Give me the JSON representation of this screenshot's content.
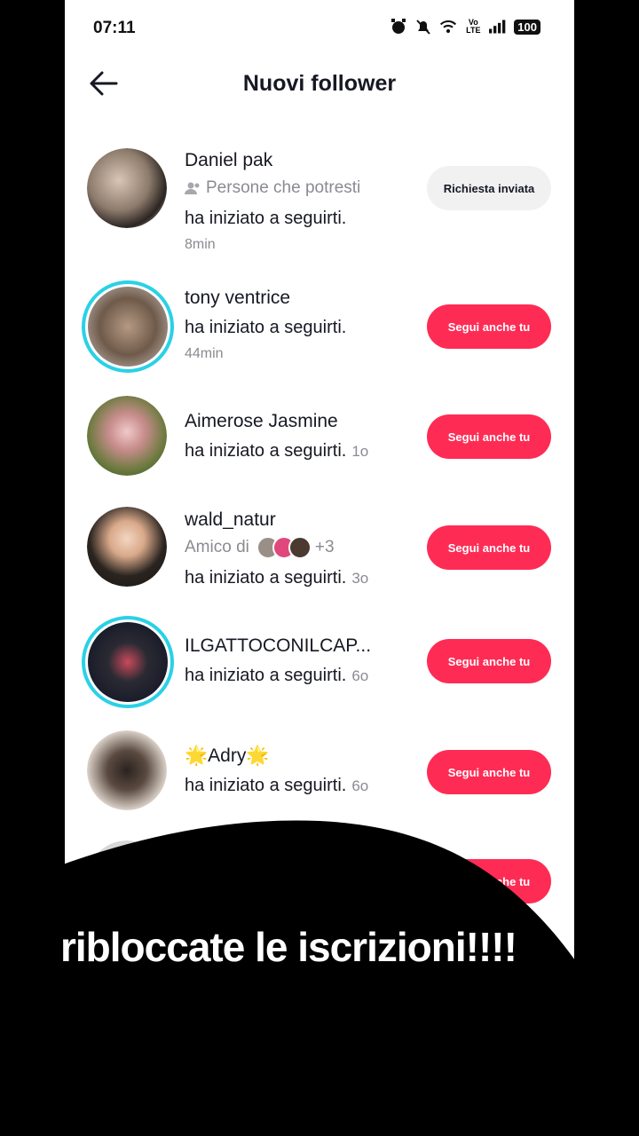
{
  "status": {
    "time": "07:11",
    "battery": "100",
    "net": "Vo LTE"
  },
  "header": {
    "title": "Nuovi follower"
  },
  "rows": [
    {
      "name": "Daniel pak",
      "sub": "Persone che potresti",
      "msg": "ha iniziato a seguirti.",
      "time": "8min",
      "button": "Richiesta inviata"
    },
    {
      "name": "tony ventrice",
      "msg": "ha iniziato a seguirti.",
      "time": "44min",
      "button": "Segui anche tu"
    },
    {
      "name": "Aimerose Jasmine",
      "msg": "ha iniziato a seguirti.",
      "time": "1o",
      "button": "Segui anche tu"
    },
    {
      "name": "wald_natur",
      "sub": "Amico di",
      "sub_more": "+3",
      "msg": "ha iniziato a seguirti.",
      "time": "3o",
      "button": "Segui anche tu"
    },
    {
      "name": "ILGATTOCONILCAP...",
      "msg": "ha iniziato a seguirti.",
      "time": "6o",
      "button": "Segui anche tu"
    },
    {
      "name": "🌟Adry🌟",
      "msg": "ha iniziato a seguirti.",
      "time": "6o",
      "button": "Segui anche tu"
    },
    {
      "button": "Segui anche tu"
    }
  ],
  "caption": "ribloccate le iscrizioni!!!!",
  "colors": {
    "accent": "#fe2c55",
    "ring": "#2ad1e6"
  }
}
